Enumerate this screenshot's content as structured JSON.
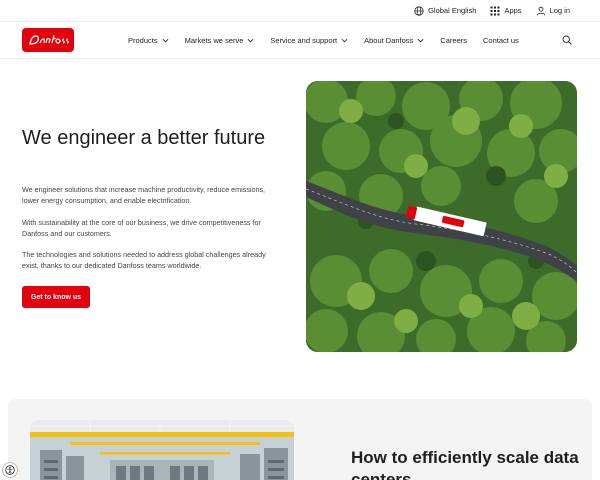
{
  "utility": {
    "language_label": "Global English",
    "apps_label": "Apps",
    "login_label": "Log in"
  },
  "nav": {
    "items": [
      {
        "label": "Products",
        "has_dropdown": true
      },
      {
        "label": "Markets we serve",
        "has_dropdown": true
      },
      {
        "label": "Service and support",
        "has_dropdown": true
      },
      {
        "label": "About Danfoss",
        "has_dropdown": true
      },
      {
        "label": "Careers",
        "has_dropdown": false
      },
      {
        "label": "Contact us",
        "has_dropdown": false
      }
    ]
  },
  "hero": {
    "title": "We engineer a better future",
    "paragraphs": [
      "We engineer solutions that increase machine productivity, reduce emissions, lower energy consumption, and enable electrification.",
      "With sustainability at the core of our business, we drive competitiveness for Danfoss and our customers.",
      "The technologies and solutions needed to address global challenges already exist, thanks to our dedicated Danfoss teams worldwide."
    ],
    "cta_label": "Get to know us"
  },
  "card": {
    "title": "How to efficiently scale data centers"
  },
  "colors": {
    "brand_red": "#e2000f",
    "text_dark": "#1e1e1e",
    "section_bg": "#f4f4f4"
  },
  "icons": {
    "language": "globe-icon",
    "apps": "grid-icon",
    "login": "user-icon",
    "search": "search-icon",
    "dropdown": "chevron-down-icon",
    "accessibility": "accessibility-icon"
  }
}
